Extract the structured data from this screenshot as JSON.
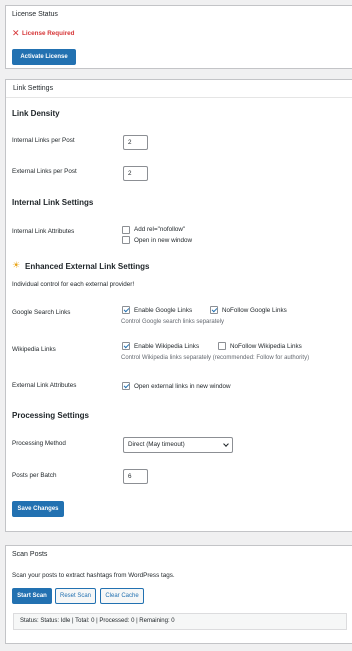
{
  "license": {
    "header": "License Status",
    "status_icon": "x-icon",
    "status_text": "License Required",
    "activate_label": "Activate License"
  },
  "settings": {
    "header": "Link Settings",
    "link_density_title": "Link Density",
    "internal_per_post_label": "Internal Links per Post",
    "internal_per_post_value": "2",
    "external_per_post_label": "External Links per Post",
    "external_per_post_value": "2",
    "internal_settings_title": "Internal Link Settings",
    "internal_attrs_label": "Internal Link Attributes",
    "add_nofollow_label": "Add rel=\"nofollow\"",
    "open_new_window_label": "Open in new window",
    "enhanced_icon": "sun-icon",
    "enhanced_title": "Enhanced External Link Settings",
    "enhanced_desc": "Individual control for each external provider!",
    "google_label": "Google Search Links",
    "enable_google_label": "Enable Google Links",
    "nofollow_google_label": "NoFollow Google Links",
    "google_desc": "Control Google search links separately",
    "wiki_label": "Wikipedia Links",
    "enable_wiki_label": "Enable Wikipedia Links",
    "nofollow_wiki_label": "NoFollow Wikipedia Links",
    "wiki_desc": "Control Wikipedia links separately (recommended: Follow for authority)",
    "external_attrs_label": "External Link Attributes",
    "open_external_label": "Open external links in new window",
    "processing_title": "Processing Settings",
    "processing_method_label": "Processing Method",
    "processing_method_value": "Direct (May timeout)",
    "posts_per_batch_label": "Posts per Batch",
    "posts_per_batch_value": "6",
    "save_label": "Save Changes"
  },
  "checkbox_states": {
    "add_nofollow": false,
    "open_new_window": false,
    "enable_google": true,
    "nofollow_google": true,
    "enable_wiki": true,
    "nofollow_wiki": false,
    "open_external": true
  },
  "scan": {
    "header": "Scan Posts",
    "desc": "Scan your posts to extract hashtags from WordPress tags.",
    "start_label": "Start Scan",
    "reset_label": "Reset Scan",
    "clear_label": "Clear Cache",
    "status_text": "Status: Status: Idle | Total: 0 | Processed: 0 | Remaining: 0"
  },
  "colors": {
    "accent": "#2271b1",
    "error": "#d63638",
    "background": "#f0f0f1",
    "card": "#ffffff"
  }
}
